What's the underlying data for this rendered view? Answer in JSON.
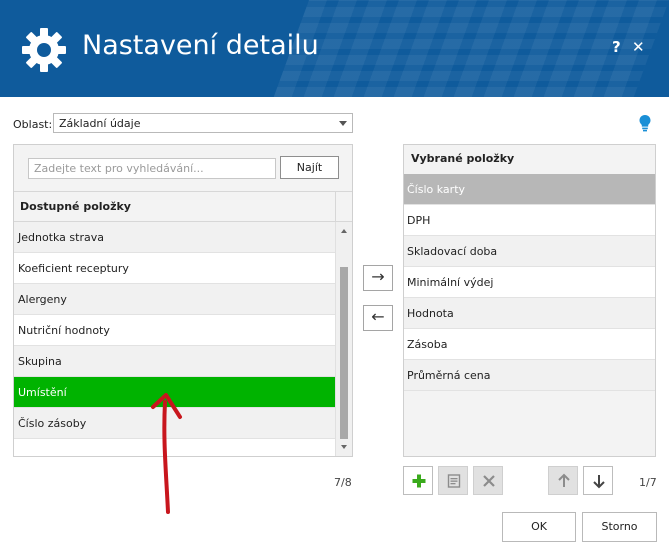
{
  "window": {
    "title": "Nastavení detailu",
    "help_label": "?",
    "close_label": "✕"
  },
  "area": {
    "label": "Oblast:",
    "value": "Základní údaje"
  },
  "search": {
    "placeholder": "Zadejte text pro vyhledávání...",
    "value": "",
    "button_label": "Najít"
  },
  "available": {
    "header": "Dostupné položky",
    "items": [
      {
        "label": "Jednotka strava",
        "selected": false
      },
      {
        "label": "Koeficient receptury",
        "selected": false
      },
      {
        "label": "Alergeny",
        "selected": false
      },
      {
        "label": "Nutriční hodnoty",
        "selected": false
      },
      {
        "label": "Skupina",
        "selected": false
      },
      {
        "label": "Umístění",
        "selected": true
      },
      {
        "label": "Číslo zásoby",
        "selected": false
      }
    ],
    "count": "7/8"
  },
  "transfer": {
    "add_icon": "arrow-right-icon",
    "add_glyph": "→",
    "remove_icon": "arrow-left-icon",
    "remove_glyph": "←"
  },
  "selected": {
    "header": "Vybrané položky",
    "items": [
      {
        "label": "Číslo karty",
        "selected": true
      },
      {
        "label": "DPH",
        "selected": false
      },
      {
        "label": "Skladovací doba",
        "selected": false
      },
      {
        "label": "Minimální výdej",
        "selected": false
      },
      {
        "label": "Hodnota",
        "selected": false
      },
      {
        "label": "Zásoba",
        "selected": false
      },
      {
        "label": "Průměrná cena",
        "selected": false
      }
    ],
    "count": "1/7"
  },
  "toolbar": {
    "icons": [
      "plus-icon",
      "edit-note-icon",
      "delete-x-icon",
      "arrow-up-icon",
      "arrow-down-icon"
    ]
  },
  "dialog": {
    "ok_label": "OK",
    "cancel_label": "Storno"
  },
  "colors": {
    "header_bg": "#0f5b9c",
    "selected_green": "#00b300",
    "selected_gray": "#b7b7b7",
    "annotation_red": "#c8161d",
    "plus_green": "#3aaa1c",
    "bulb_blue": "#1a8fd6"
  }
}
